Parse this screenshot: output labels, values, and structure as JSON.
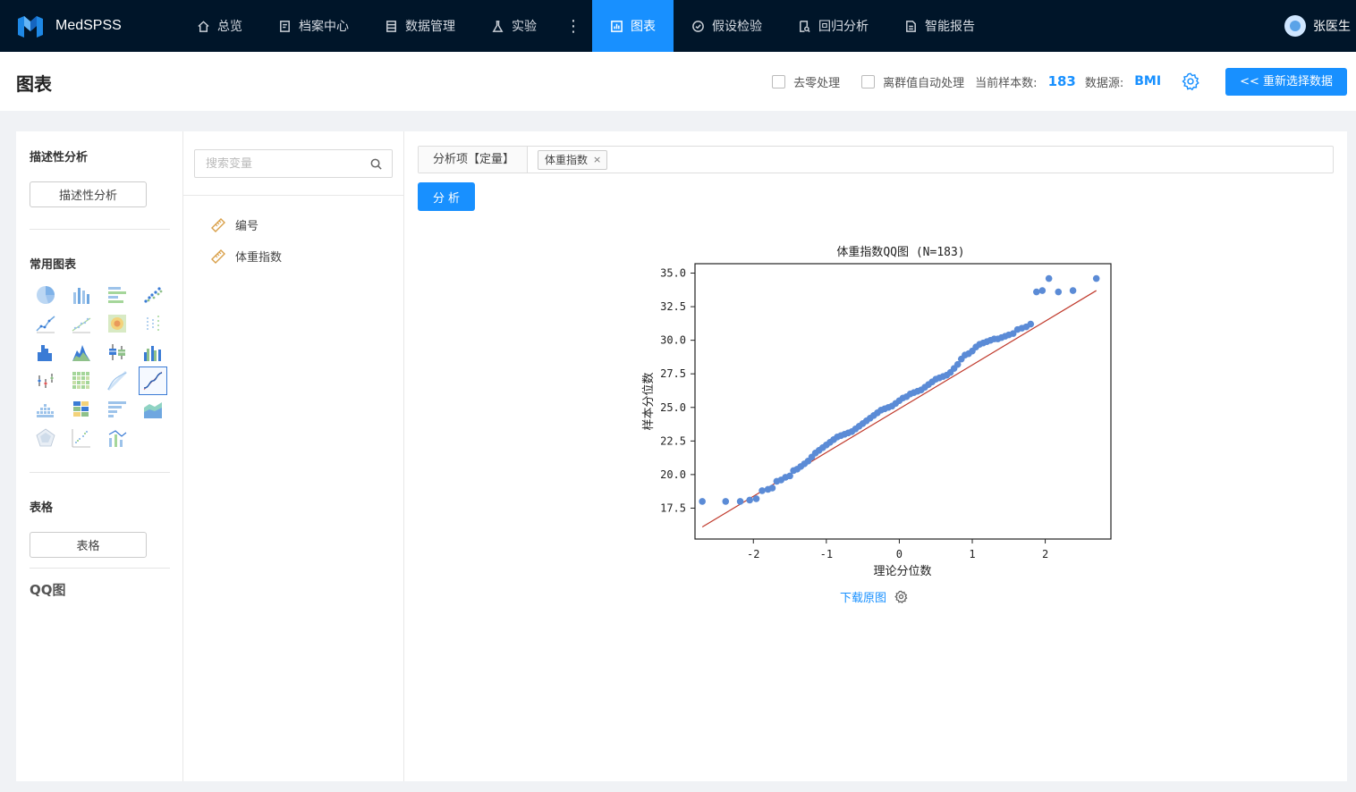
{
  "brand": {
    "name": "MedSPSS"
  },
  "nav": {
    "items": [
      {
        "label": "总览",
        "icon": "home-icon"
      },
      {
        "label": "档案中心",
        "icon": "archive-icon"
      },
      {
        "label": "数据管理",
        "icon": "data-icon"
      },
      {
        "label": "实验",
        "icon": "flask-icon"
      },
      {
        "label": "图表",
        "icon": "chart-icon",
        "active": true
      },
      {
        "label": "假设检验",
        "icon": "check-circle-icon"
      },
      {
        "label": "回归分析",
        "icon": "regression-icon"
      },
      {
        "label": "智能报告",
        "icon": "report-icon"
      }
    ],
    "more": "⋮",
    "user": "张医生"
  },
  "header": {
    "title": "图表",
    "zero_label": "去零处理",
    "outlier_label": "离群值自动处理",
    "sample_label": "当前样本数:",
    "sample_value": "183",
    "datasource_label": "数据源:",
    "datasource_value": "BMI",
    "reselect_label": "<< 重新选择数据"
  },
  "left": {
    "descriptive_title": "描述性分析",
    "descriptive_button": "描述性分析",
    "common_title": "常用图表",
    "table_title": "表格",
    "table_button": "表格",
    "current_chart": "QQ图"
  },
  "vars": {
    "search_placeholder": "搜索变量",
    "items": [
      "编号",
      "体重指数"
    ]
  },
  "main": {
    "analysis_label": "分析项【定量】",
    "tag_label": "体重指数",
    "tag_close": "×",
    "analyze_label": "分析",
    "download_label": "下载原图"
  },
  "colors": {
    "accent": "#1890ff",
    "nav_bg": "#001529",
    "point": "#5b8bd6",
    "line": "#c0392b"
  },
  "chart_data": {
    "type": "scatter",
    "title": "体重指数QQ图 (N=183)",
    "xlabel": "理论分位数",
    "ylabel": "样本分位数",
    "xlim": [
      -2.8,
      2.9
    ],
    "ylim": [
      15.2,
      35.7
    ],
    "xticks": [
      "-2",
      "-1",
      "0",
      "1",
      "2"
    ],
    "xtick_values": [
      -2,
      -1,
      0,
      1,
      2
    ],
    "yticks": [
      "17.5",
      "20.0",
      "22.5",
      "25.0",
      "27.5",
      "30.0",
      "32.5",
      "35.0"
    ],
    "ytick_values": [
      17.5,
      20,
      22.5,
      25,
      27.5,
      30,
      32.5,
      35
    ],
    "reference_line": {
      "x": [
        -2.7,
        2.7
      ],
      "y": [
        16.1,
        33.7
      ]
    },
    "series": [
      {
        "x": [
          -2.7,
          -2.38,
          -2.18,
          -2.05,
          -1.96,
          -1.88,
          -1.8,
          -1.74,
          -1.68,
          -1.62,
          -1.56,
          -1.5,
          -1.45,
          -1.4,
          -1.35,
          -1.3,
          -1.25,
          -1.2,
          -1.15,
          -1.1,
          -1.05,
          -1.0,
          -0.95,
          -0.9,
          -0.85,
          -0.8,
          -0.75,
          -0.7,
          -0.65,
          -0.6,
          -0.55,
          -0.5,
          -0.45,
          -0.4,
          -0.35,
          -0.3,
          -0.25,
          -0.2,
          -0.15,
          -0.1,
          -0.05,
          0.0,
          0.05,
          0.1,
          0.15,
          0.2,
          0.25,
          0.3,
          0.35,
          0.4,
          0.45,
          0.5,
          0.55,
          0.6,
          0.65,
          0.7,
          0.75,
          0.8,
          0.85,
          0.9,
          0.95,
          1.0,
          1.05,
          1.1,
          1.15,
          1.2,
          1.25,
          1.3,
          1.35,
          1.4,
          1.45,
          1.5,
          1.56,
          1.62,
          1.68,
          1.74,
          1.8,
          1.88,
          1.96,
          2.05,
          2.18,
          2.38,
          2.7
        ],
        "y": [
          18.0,
          18.0,
          18.0,
          18.1,
          18.2,
          18.8,
          18.9,
          19.0,
          19.5,
          19.6,
          19.8,
          19.9,
          20.3,
          20.4,
          20.6,
          20.8,
          21.0,
          21.3,
          21.6,
          21.8,
          22.0,
          22.2,
          22.4,
          22.6,
          22.8,
          22.9,
          23.0,
          23.1,
          23.2,
          23.4,
          23.6,
          23.8,
          24.0,
          24.2,
          24.4,
          24.6,
          24.8,
          24.9,
          25.0,
          25.1,
          25.3,
          25.5,
          25.7,
          25.8,
          26.0,
          26.1,
          26.2,
          26.3,
          26.5,
          26.7,
          26.9,
          27.1,
          27.2,
          27.3,
          27.4,
          27.6,
          27.9,
          28.2,
          28.6,
          28.9,
          29.0,
          29.2,
          29.5,
          29.7,
          29.8,
          29.9,
          30.0,
          30.1,
          30.1,
          30.2,
          30.3,
          30.4,
          30.5,
          30.8,
          30.9,
          31.0,
          31.2,
          33.6,
          33.7,
          34.6,
          33.6,
          33.7,
          34.6
        ]
      }
    ]
  }
}
